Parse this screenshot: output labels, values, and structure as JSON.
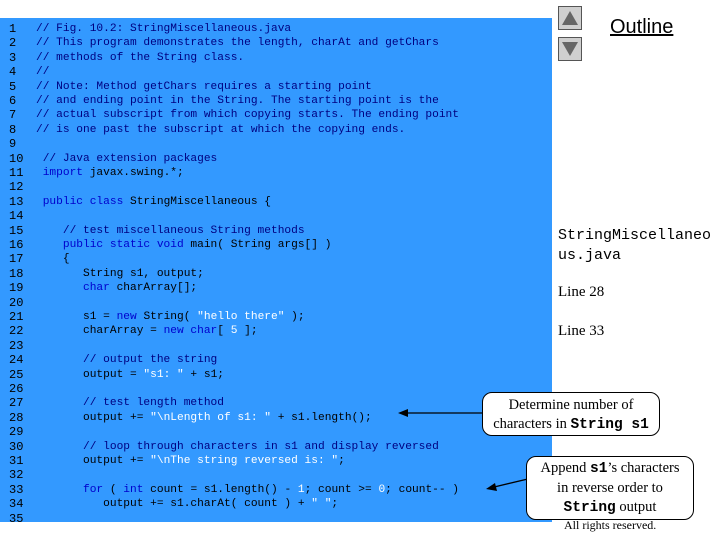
{
  "outline_title": "Outline",
  "file_title": "StringMiscellaneous.java",
  "side_links": [
    "Line 28",
    "Line 33"
  ],
  "callouts": {
    "length": {
      "text1": "Determine number of",
      "text2": "characters in ",
      "code": "String s1"
    },
    "reverse": {
      "text1": "Append ",
      "code1": "s1",
      "text2": "’s characters",
      "text3": "in reverse order to",
      "code2": "String",
      "text4": " output"
    }
  },
  "rights": "All rights reserved.",
  "nav": {
    "up": "up-arrow",
    "down": "down-arrow"
  },
  "colors": {
    "panel": "#3399ff",
    "keyword": "#0000cc",
    "string": "#ffffff",
    "comment": "#000080"
  },
  "code": [
    [
      [
        "cm",
        "// Fig. 10.2: StringMiscellaneous.java"
      ]
    ],
    [
      [
        "cm",
        "// This program demonstrates the length, charAt and getChars"
      ]
    ],
    [
      [
        "cm",
        "// methods of the String class."
      ]
    ],
    [
      [
        "cm",
        "//"
      ]
    ],
    [
      [
        "cm",
        "// Note: Method getChars requires a starting point"
      ]
    ],
    [
      [
        "cm",
        "// and ending point in the String. The starting point is the"
      ]
    ],
    [
      [
        "cm",
        "// actual subscript from which copying starts. The ending point"
      ]
    ],
    [
      [
        "cm",
        "// is one past the subscript at which the copying ends."
      ]
    ],
    [],
    [
      [
        "cm",
        " // Java extension packages"
      ]
    ],
    [
      [
        "kw",
        " import"
      ],
      [
        "plain",
        " javax.swing.*;"
      ]
    ],
    [],
    [
      [
        "kw",
        " public class"
      ],
      [
        "plain",
        " StringMiscellaneous {"
      ]
    ],
    [],
    [
      [
        "cm",
        "    // test miscellaneous String methods"
      ]
    ],
    [
      [
        "kw",
        "    public static void"
      ],
      [
        "plain",
        " main( String args[] )"
      ]
    ],
    [
      [
        "plain",
        "    {"
      ]
    ],
    [
      [
        "plain",
        "       String s1, output;"
      ]
    ],
    [
      [
        "kw",
        "       char"
      ],
      [
        "plain",
        " charArray[];"
      ]
    ],
    [],
    [
      [
        "plain",
        "       s1 = "
      ],
      [
        "kw",
        "new"
      ],
      [
        "plain",
        " String( "
      ],
      [
        "str",
        "\"hello there\""
      ],
      [
        "plain",
        " );"
      ]
    ],
    [
      [
        "plain",
        "       charArray = "
      ],
      [
        "kw",
        "new char"
      ],
      [
        "plain",
        "[ "
      ],
      [
        "num",
        "5"
      ],
      [
        "plain",
        " ];"
      ]
    ],
    [],
    [
      [
        "cm",
        "       // output the string"
      ]
    ],
    [
      [
        "plain",
        "       output = "
      ],
      [
        "str",
        "\"s1: \""
      ],
      [
        "plain",
        " + s1;"
      ]
    ],
    [],
    [
      [
        "cm",
        "       // test length method"
      ]
    ],
    [
      [
        "plain",
        "       output += "
      ],
      [
        "str",
        "\"\\nLength of s1: \""
      ],
      [
        "plain",
        " + s1.length();"
      ]
    ],
    [],
    [
      [
        "cm",
        "       // loop through characters in s1 and display reversed"
      ]
    ],
    [
      [
        "plain",
        "       output += "
      ],
      [
        "str",
        "\"\\nThe string reversed is: \""
      ],
      [
        "plain",
        ";"
      ]
    ],
    [],
    [
      [
        "kw",
        "       for"
      ],
      [
        "plain",
        " ( "
      ],
      [
        "kw",
        "int"
      ],
      [
        "plain",
        " count = s1.length() - "
      ],
      [
        "num",
        "1"
      ],
      [
        "plain",
        "; count >= "
      ],
      [
        "num",
        "0"
      ],
      [
        "plain",
        "; count-- )"
      ]
    ],
    [
      [
        "plain",
        "          output += s1.charAt( count ) + "
      ],
      [
        "str",
        "\" \""
      ],
      [
        "plain",
        ";"
      ]
    ],
    []
  ]
}
